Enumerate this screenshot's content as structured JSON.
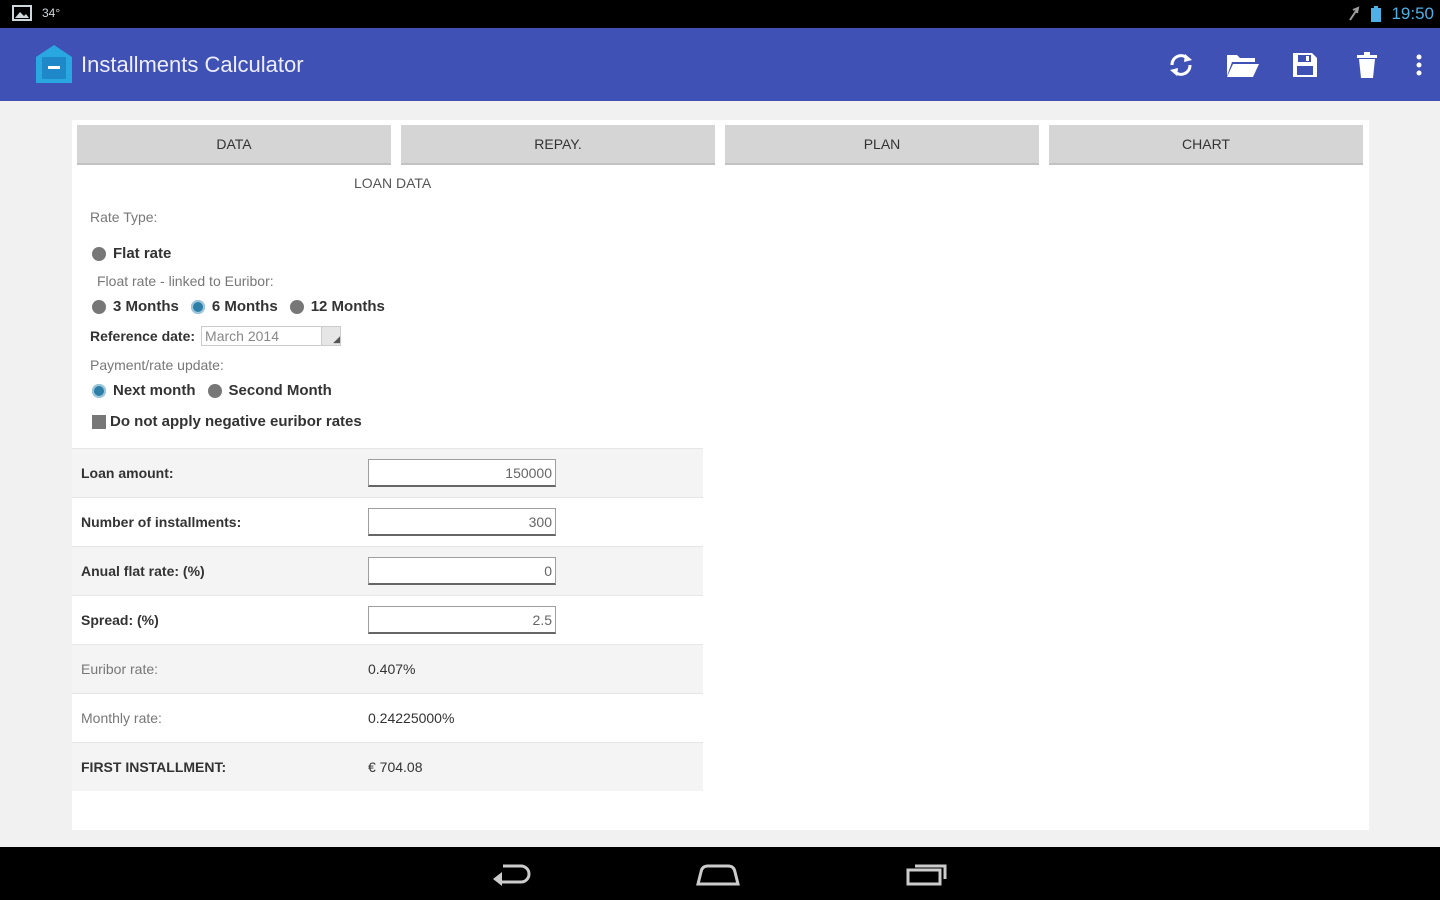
{
  "status": {
    "time": "19:50",
    "left_text": "34°"
  },
  "app": {
    "title": "Installments Calculator"
  },
  "tabs": [
    "DATA",
    "REPAY.",
    "PLAN",
    "CHART"
  ],
  "loan_data": {
    "section_title": "LOAN DATA",
    "rate_type_label": "Rate Type:",
    "flat_rate_label": "Flat rate",
    "float_rate_label": "Float rate - linked to Euribor:",
    "float_options": [
      "3 Months",
      "6 Months",
      "12 Months"
    ],
    "float_selected": "6 Months",
    "reference_date_label": "Reference date:",
    "reference_date_value": "March 2014",
    "payment_update_label": "Payment/rate update:",
    "payment_options": [
      "Next month",
      "Second Month"
    ],
    "payment_selected": "Next month",
    "negative_euribor_label": "Do not apply negative euribor rates"
  },
  "fields": {
    "loan_amount_label": "Loan amount:",
    "loan_amount_value": "150000",
    "installments_label": "Number of installments:",
    "installments_value": "300",
    "flat_rate_label": "Anual flat rate: (%)",
    "flat_rate_value": "0",
    "spread_label": "Spread: (%)",
    "spread_value": "2.5"
  },
  "results": {
    "euribor_label": "Euribor rate:",
    "euribor_value": "0.407%",
    "monthly_label": "Monthly rate:",
    "monthly_value": "0.24225000%",
    "first_label": "FIRST INSTALLMENT:",
    "first_value": "€ 704.08"
  },
  "colors": {
    "appbar": "#3f51b5",
    "accent": "#2e7fa8"
  },
  "icons": [
    "refresh-icon",
    "folder-open-icon",
    "save-icon",
    "delete-icon",
    "overflow-menu-icon"
  ]
}
